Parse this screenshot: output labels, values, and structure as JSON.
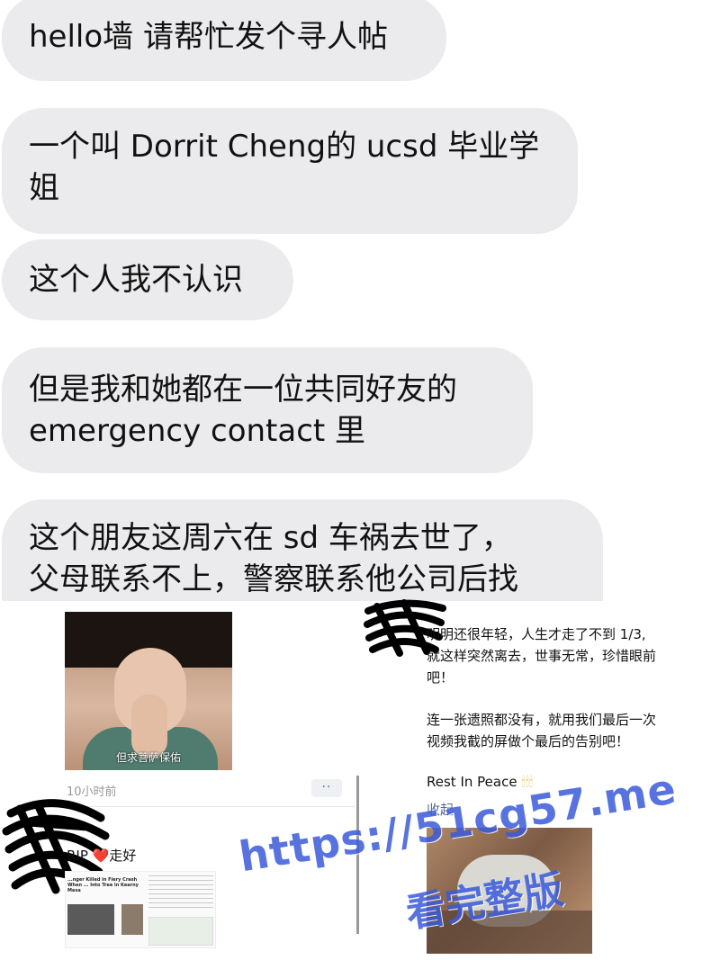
{
  "chat": {
    "bubbles": [
      {
        "lines": [
          "hello墙 请帮忙发个寻人帖"
        ]
      },
      {
        "lines": [
          "一个叫 Dorrit Cheng的 ucsd 毕业学",
          "姐"
        ]
      },
      {
        "lines": [
          "这个人我不认识"
        ]
      },
      {
        "lines": [
          "但是我和她都在一位共同好友的",
          "emergency contact 里"
        ]
      },
      {
        "lines": [
          "这个朋友这周六在 sd 车祸去世了，",
          "父母联系不上，警察联系他公司后找"
        ]
      }
    ]
  },
  "left_post": {
    "image_caption": "但求菩萨保佑",
    "timestamp": "10小时前",
    "more_icon": "more-dots-icon",
    "more_label": "··",
    "comment_text": "RIP",
    "comment_heart": "❤️",
    "comment_suffix": "走好",
    "article_headline": "...nger Killed in Fiery Crash When ... Into Tree in Kearny Mesa"
  },
  "right_post": {
    "lines": [
      "明明还很年轻，人生才走了不到 1/3,",
      "就这样突然离去，世事无常，珍惜眼前",
      "吧！",
      "连一张遗照都没有，就用我们最后一次",
      "视频我截的屏做个最后的告别吧！"
    ],
    "rip": "Rest In Peace",
    "candles": "🕯🕯🕯",
    "collapse_label": "收起"
  },
  "watermark": {
    "url": "https://51cg57.me",
    "subtitle": "看完整版"
  },
  "colors": {
    "bubble": "#ebebed",
    "link_blue": "#576b95",
    "watermark": "#3b5bdb",
    "heart": "#e0202c"
  }
}
